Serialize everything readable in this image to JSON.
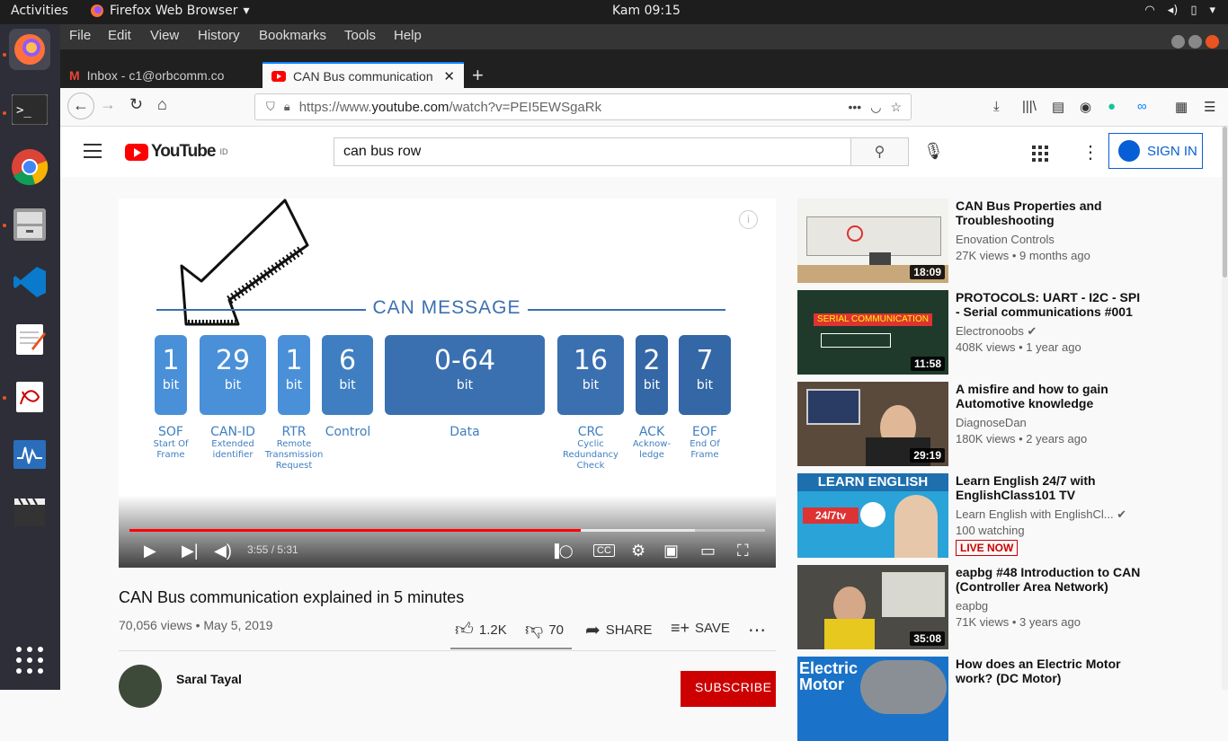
{
  "system": {
    "activities": "Activities",
    "app_name": "Firefox Web Browser",
    "clock": "Kam 09:15"
  },
  "menu": [
    "File",
    "Edit",
    "View",
    "History",
    "Bookmarks",
    "Tools",
    "Help"
  ],
  "tabs": [
    {
      "label": "Inbox - c1@orbcomm.co"
    },
    {
      "label": "CAN Bus communication"
    }
  ],
  "url": {
    "prefix": "https://www.",
    "domain": "youtube.com",
    "path": "/watch?v=PEI5EWSgaRk"
  },
  "youtube": {
    "logo": "YouTube",
    "region": "ID",
    "search_value": "can bus row",
    "sign_in": "SIGN IN"
  },
  "slide": {
    "title": "CAN MESSAGE",
    "bit_word": "bit",
    "fields": [
      {
        "num": "1",
        "label": "SOF",
        "sub": "Start Of\nFrame"
      },
      {
        "num": "29",
        "label": "CAN-ID",
        "sub": "Extended\nidentifier"
      },
      {
        "num": "1",
        "label": "RTR",
        "sub": "Remote\nTransmission\nRequest"
      },
      {
        "num": "6",
        "label": "Control",
        "sub": ""
      },
      {
        "num": "0-64",
        "label": "Data",
        "sub": ""
      },
      {
        "num": "16",
        "label": "CRC",
        "sub": "Cyclic\nRedundancy\nCheck"
      },
      {
        "num": "2",
        "label": "ACK",
        "sub": "Acknow-\nledge"
      },
      {
        "num": "7",
        "label": "EOF",
        "sub": "End Of\nFrame"
      }
    ]
  },
  "player": {
    "current": "3:55",
    "duration": "5:31",
    "progress": 0.71,
    "buffered": 0.89
  },
  "video": {
    "title": "CAN Bus communication explained in 5 minutes",
    "meta": "70,056 views • May 5, 2019",
    "likes": "1.2K",
    "dislikes": "70",
    "share": "SHARE",
    "save": "SAVE",
    "channel": "Saral Tayal",
    "subscribe": "SUBSCRIBE"
  },
  "recommendations": [
    {
      "title": "CAN Bus Properties and Troubleshooting",
      "channel": "Enovation Controls",
      "views": "27K views • 9 months ago",
      "duration": "18:09",
      "verified": false,
      "live": false
    },
    {
      "title": "PROTOCOLS: UART - I2C - SPI - Serial communications #001",
      "channel": "Electronoobs",
      "views": "408K views • 1 year ago",
      "duration": "11:58",
      "verified": true,
      "live": false
    },
    {
      "title": "A misfire and how to gain Automotive knowledge",
      "channel": "DiagnoseDan",
      "views": "180K views • 2 years ago",
      "duration": "29:19",
      "verified": false,
      "live": false
    },
    {
      "title": "Learn English 24/7 with EnglishClass101 TV",
      "channel": "Learn English with EnglishCl...",
      "views": "100 watching",
      "duration": "",
      "verified": true,
      "live": true,
      "live_label": "LIVE NOW"
    },
    {
      "title": "eapbg #48 Introduction to CAN (Controller Area Network)",
      "channel": "eapbg",
      "views": "71K views • 3 years ago",
      "duration": "35:08",
      "verified": false,
      "live": false
    },
    {
      "title": "How does an Electric Motor work? (DC Motor)",
      "channel": "",
      "views": "",
      "duration": "",
      "verified": false,
      "live": false
    }
  ],
  "colors": {
    "yt_red": "#ff0000",
    "slide_blue": "#3c6fb0",
    "link_blue": "#065fd4"
  }
}
